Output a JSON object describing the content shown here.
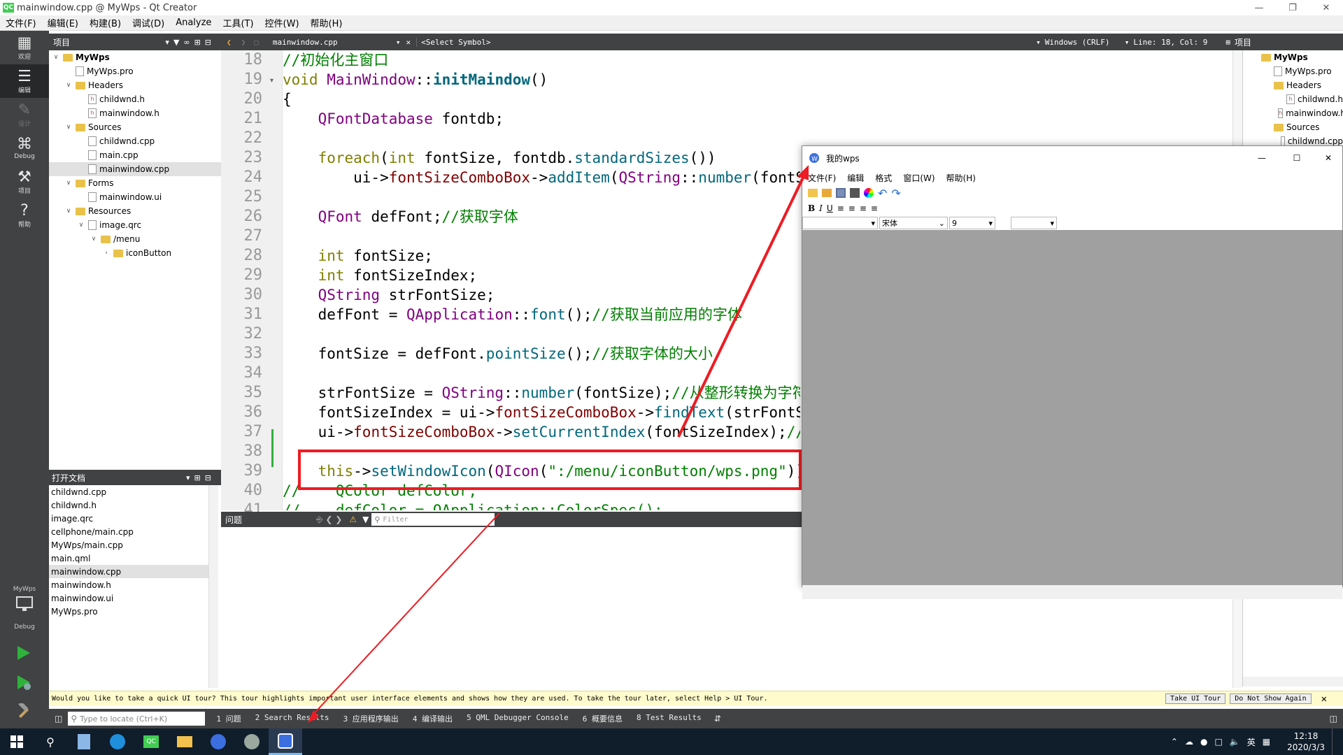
{
  "window": {
    "title": "mainwindow.cpp @ MyWps - Qt Creator",
    "app_badge": "QC"
  },
  "menu": [
    "文件(F)",
    "编辑(E)",
    "构建(B)",
    "调试(D)",
    "Analyze",
    "工具(T)",
    "控件(W)",
    "帮助(H)"
  ],
  "modes": [
    {
      "label": "欢迎",
      "icon": "grid-icon"
    },
    {
      "label": "编辑",
      "icon": "edit-icon"
    },
    {
      "label": "设计",
      "icon": "pencil-icon"
    },
    {
      "label": "Debug",
      "icon": "bug-icon"
    },
    {
      "label": "项目",
      "icon": "wrench-icon"
    },
    {
      "label": "帮助",
      "icon": "help-icon"
    }
  ],
  "kit": {
    "project": "MyWps",
    "config": "Debug"
  },
  "projects_pane": {
    "title": "项目"
  },
  "project_tree": [
    {
      "label": "MyWps",
      "depth": 0,
      "kind": "project",
      "arrow": "v",
      "bold": true
    },
    {
      "label": "MyWps.pro",
      "depth": 1,
      "kind": "file"
    },
    {
      "label": "Headers",
      "depth": 1,
      "kind": "folder",
      "arrow": "v"
    },
    {
      "label": "childwnd.h",
      "depth": 2,
      "kind": "hfile"
    },
    {
      "label": "mainwindow.h",
      "depth": 2,
      "kind": "hfile"
    },
    {
      "label": "Sources",
      "depth": 1,
      "kind": "folder",
      "arrow": "v"
    },
    {
      "label": "childwnd.cpp",
      "depth": 2,
      "kind": "file"
    },
    {
      "label": "main.cpp",
      "depth": 2,
      "kind": "file"
    },
    {
      "label": "mainwindow.cpp",
      "depth": 2,
      "kind": "file",
      "selected": true
    },
    {
      "label": "Forms",
      "depth": 1,
      "kind": "folder",
      "arrow": "v"
    },
    {
      "label": "mainwindow.ui",
      "depth": 2,
      "kind": "file"
    },
    {
      "label": "Resources",
      "depth": 1,
      "kind": "folder",
      "arrow": "v"
    },
    {
      "label": "image.qrc",
      "depth": 2,
      "kind": "file",
      "arrow": "v"
    },
    {
      "label": "/menu",
      "depth": 3,
      "kind": "folder",
      "arrow": "v"
    },
    {
      "label": "iconButton",
      "depth": 4,
      "kind": "folder",
      "arrow": ">"
    }
  ],
  "open_docs": {
    "title": "打开文档",
    "items": [
      "childwnd.cpp",
      "childwnd.h",
      "image.qrc",
      "cellphone/main.cpp",
      "MyWps/main.cpp",
      "main.qml",
      "mainwindow.cpp",
      "mainwindow.h",
      "mainwindow.ui",
      "MyWps.pro"
    ],
    "selected": "mainwindow.cpp"
  },
  "editor": {
    "file": "mainwindow.cpp",
    "symbol": "<Select Symbol>",
    "encoding": "Windows (CRLF)",
    "position": "Line: 18, Col: 9",
    "right_pane_title": "项目"
  },
  "code_lines": [
    {
      "n": "18",
      "t": [
        [
          "cm",
          "//初始化主窗口"
        ]
      ]
    },
    {
      "n": "19",
      "t": [
        [
          "kw",
          "void "
        ],
        [
          "ty",
          "MainWindow"
        ],
        [
          "",
          "::"
        ],
        [
          "fn bd",
          "initMaindow"
        ],
        [
          "",
          "()"
        ]
      ]
    },
    {
      "n": "20",
      "t": [
        [
          "",
          "{"
        ]
      ]
    },
    {
      "n": "21",
      "t": [
        [
          "",
          "    "
        ],
        [
          "ty",
          "QFontDatabase"
        ],
        [
          "",
          " fontdb;"
        ]
      ]
    },
    {
      "n": "22",
      "t": []
    },
    {
      "n": "23",
      "t": [
        [
          "",
          "    "
        ],
        [
          "kw",
          "foreach"
        ],
        [
          "",
          "("
        ],
        [
          "kw",
          "int"
        ],
        [
          "",
          " fontSize, fontdb."
        ],
        [
          "fn",
          "standardSizes"
        ],
        [
          "",
          "())"
        ]
      ]
    },
    {
      "n": "24",
      "t": [
        [
          "",
          "        ui->"
        ],
        [
          "mc",
          "fontSizeComboBox"
        ],
        [
          "",
          "->"
        ],
        [
          "fn",
          "addItem"
        ],
        [
          "",
          "("
        ],
        [
          "ty",
          "QString"
        ],
        [
          "",
          "::"
        ],
        [
          "fn",
          "number"
        ],
        [
          "",
          "(fontSize));"
        ]
      ]
    },
    {
      "n": "25",
      "t": []
    },
    {
      "n": "26",
      "t": [
        [
          "",
          "    "
        ],
        [
          "ty",
          "QFont"
        ],
        [
          "",
          " defFont;"
        ],
        [
          "cm",
          "//获取字体"
        ]
      ]
    },
    {
      "n": "27",
      "t": []
    },
    {
      "n": "28",
      "t": [
        [
          "",
          "    "
        ],
        [
          "kw",
          "int"
        ],
        [
          "",
          " fontSize;"
        ]
      ]
    },
    {
      "n": "29",
      "t": [
        [
          "",
          "    "
        ],
        [
          "kw",
          "int"
        ],
        [
          "",
          " fontSizeIndex;"
        ]
      ]
    },
    {
      "n": "30",
      "t": [
        [
          "",
          "    "
        ],
        [
          "ty",
          "QString"
        ],
        [
          "",
          " strFontSize;"
        ]
      ]
    },
    {
      "n": "31",
      "t": [
        [
          "",
          "    defFont = "
        ],
        [
          "ty",
          "QApplication"
        ],
        [
          "",
          "::"
        ],
        [
          "fn",
          "font"
        ],
        [
          "",
          "();"
        ],
        [
          "cm",
          "//获取当前应用的字体"
        ]
      ]
    },
    {
      "n": "32",
      "t": []
    },
    {
      "n": "33",
      "t": [
        [
          "",
          "    fontSize = defFont."
        ],
        [
          "fn",
          "pointSize"
        ],
        [
          "",
          "();"
        ],
        [
          "cm",
          "//获取字体的大小"
        ]
      ]
    },
    {
      "n": "34",
      "t": []
    },
    {
      "n": "35",
      "t": [
        [
          "",
          "    strFontSize = "
        ],
        [
          "ty",
          "QString"
        ],
        [
          "",
          "::"
        ],
        [
          "fn",
          "number"
        ],
        [
          "",
          "(fontSize);"
        ],
        [
          "cm",
          "//从整形转换为字符串"
        ]
      ]
    },
    {
      "n": "36",
      "t": [
        [
          "",
          "    fontSizeIndex = ui->"
        ],
        [
          "mc",
          "fontSizeComboBox"
        ],
        [
          "",
          "->"
        ],
        [
          "fn",
          "findText"
        ],
        [
          "",
          "(strFontSize);"
        ]
      ]
    },
    {
      "n": "37",
      "t": [
        [
          "",
          "    ui->"
        ],
        [
          "mc",
          "fontSizeComboBox"
        ],
        [
          "",
          "->"
        ],
        [
          "fn",
          "setCurrentIndex"
        ],
        [
          "",
          "(fontSizeIndex);"
        ],
        [
          "cm",
          "//设置"
        ]
      ]
    },
    {
      "n": "38",
      "t": []
    },
    {
      "n": "39",
      "t": [
        [
          "",
          "    "
        ],
        [
          "kw",
          "this"
        ],
        [
          "",
          "->"
        ],
        [
          "fn",
          "setWindowIcon"
        ],
        [
          "",
          "("
        ],
        [
          "ty",
          "QIcon"
        ],
        [
          "",
          "("
        ],
        [
          "st",
          "\":/menu/iconButton/wps.png\""
        ],
        [
          "",
          "));"
        ]
      ]
    },
    {
      "n": "40",
      "t": [
        [
          "cm",
          "//    QColor defColor;"
        ]
      ]
    },
    {
      "n": "41",
      "t": [
        [
          "cm",
          "//    defColor = QApplication::ColorSpec();"
        ]
      ]
    }
  ],
  "issues": {
    "title": "问题",
    "filter_placeholder": "Filter"
  },
  "right_tree": [
    {
      "label": "MyWps",
      "depth": 0,
      "kind": "project",
      "bold": true
    },
    {
      "label": "MyWps.pro",
      "depth": 1,
      "kind": "file"
    },
    {
      "label": "Headers",
      "depth": 1,
      "kind": "folder"
    },
    {
      "label": "childwnd.h",
      "depth": 2,
      "kind": "hfile"
    },
    {
      "label": "mainwindow.h",
      "depth": 2,
      "kind": "hfile"
    },
    {
      "label": "Sources",
      "depth": 1,
      "kind": "folder"
    },
    {
      "label": "childwnd.cpp",
      "depth": 2,
      "kind": "file"
    }
  ],
  "tour": {
    "message": "Would you like to take a quick UI tour? This tour highlights important user interface elements and shows how they are used. To take the tour later, select Help > UI Tour.",
    "take_label": "Take UI Tour",
    "dismiss_label": "Do Not Show Again"
  },
  "bottom": {
    "locator_placeholder": "Type to locate (Ctrl+K)",
    "tabs": [
      "1 问题",
      "2 Search Results",
      "3 应用程序输出",
      "4 编译输出",
      "5 QML Debugger Console",
      "6 概要信息",
      "8 Test Results"
    ]
  },
  "wps": {
    "title": "我的wps",
    "menu": [
      "文件(F)",
      "编辑",
      "格式",
      "窗口(W)",
      "帮助(H)"
    ],
    "font": "宋体",
    "size": "9",
    "format_buttons": [
      "B",
      "I",
      "U"
    ]
  },
  "taskbar": {
    "time": "12:18",
    "date": "2020/3/3",
    "ime": "英"
  },
  "colors": {
    "dark": "#404244",
    "annotation_red": "#ed1c24",
    "taskbar": "#101d2b"
  }
}
